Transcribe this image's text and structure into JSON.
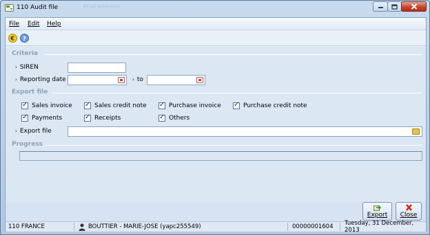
{
  "window": {
    "title": "110 Audit file",
    "background_tab": "Prud adeuum"
  },
  "menu": {
    "file": "File",
    "edit": "Edit",
    "help": "Help"
  },
  "toolbar": {
    "icons": [
      "euro-icon",
      "help-icon"
    ]
  },
  "criteria": {
    "section_title": "Criteria",
    "siren_label": "SIREN",
    "siren_value": "",
    "reporting_date_label": "Reporting date",
    "reporting_date_value": "",
    "to_label": "to",
    "to_value": ""
  },
  "export_file_section": {
    "section_title": "Export file",
    "checkboxes": [
      {
        "label": "Sales invoice",
        "checked": true
      },
      {
        "label": "Sales credit note",
        "checked": true
      },
      {
        "label": "Purchase invoice",
        "checked": true
      },
      {
        "label": "Purchase credit note",
        "checked": true
      },
      {
        "label": "Payments",
        "checked": true
      },
      {
        "label": "Receipts",
        "checked": true
      },
      {
        "label": "Others",
        "checked": true
      }
    ],
    "export_file_label": "Export file",
    "export_file_value": ""
  },
  "progress": {
    "section_title": "Progress",
    "value": 0
  },
  "buttons": {
    "export": "Export",
    "close": "Close"
  },
  "status": {
    "company": "110 FRANCE",
    "user": "BOUTTIER - MARIE-JOSE (yapc255549)",
    "number": "00000001604",
    "date": "Tuesday, 31 December, 2013"
  }
}
